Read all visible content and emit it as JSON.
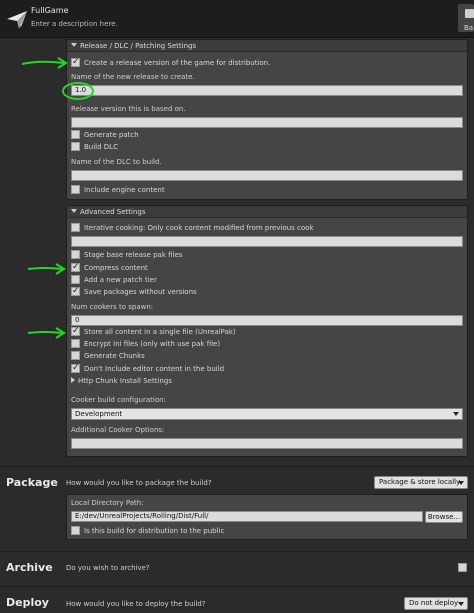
{
  "header": {
    "title": "FullGame",
    "description": "Enter a description here.",
    "back_label": "Ba"
  },
  "release": {
    "heading": "Release / DLC / Patching Settings",
    "create_release": {
      "label": "Create a release version of the game for distribution.",
      "checked": true
    },
    "release_name_label": "Name of the new release to create.",
    "release_name_value": "1.0",
    "based_on_label": "Release version this is based on.",
    "based_on_value": "",
    "generate_patch": {
      "label": "Generate patch",
      "checked": false
    },
    "build_dlc": {
      "label": "Build DLC",
      "checked": false
    },
    "dlc_name_label": "Name of the DLC to build.",
    "dlc_name_value": "",
    "include_engine": {
      "label": "Include engine content",
      "checked": false
    }
  },
  "advanced": {
    "heading": "Advanced Settings",
    "iterative": {
      "label": "Iterative cooking: Only cook content modified from previous cook",
      "checked": false
    },
    "iterative_value": "",
    "stage_base": {
      "label": "Stage base release pak files",
      "checked": false
    },
    "compress": {
      "label": "Compress content",
      "checked": true
    },
    "new_patch_tier": {
      "label": "Add a new patch tier",
      "checked": false
    },
    "save_packages": {
      "label": "Save packages without versions",
      "checked": true
    },
    "num_cookers_label": "Num cookers to spawn:",
    "num_cookers_value": "0",
    "single_file": {
      "label": "Store all content in a single file (UnrealPak)",
      "checked": true
    },
    "encrypt_ini": {
      "label": "Encrypt ini files (only with use pak file)",
      "checked": false
    },
    "generate_chunks": {
      "label": "Generate Chunks",
      "checked": false
    },
    "dont_include_editor": {
      "label": "Don't Include editor content in the build",
      "checked": true
    },
    "http_chunk": "Http Chunk Install Settings",
    "cooker_build_label": "Cooker build configuration:",
    "cooker_build_value": "Development",
    "additional_options_label": "Additional Cooker Options:",
    "additional_options_value": ""
  },
  "package": {
    "title": "Package",
    "question": "How would you like to package the build?",
    "dropdown": "Package & store locally",
    "local_dir_label": "Local Directory Path:",
    "local_dir_value": "E:/dev/UnrealProjects/Rolling/Dist/Full/",
    "browse": "Browse...",
    "distribution": {
      "label": "Is this build for distribution to the public",
      "checked": false
    }
  },
  "archive": {
    "title": "Archive",
    "question": "Do you wish to archive?"
  },
  "deploy": {
    "title": "Deploy",
    "question": "How would you like to deploy the build?",
    "dropdown": "Do not deploy"
  },
  "colors": {
    "annotation": "#22d822",
    "panel": "#454545",
    "background": "#2b2b2b"
  }
}
